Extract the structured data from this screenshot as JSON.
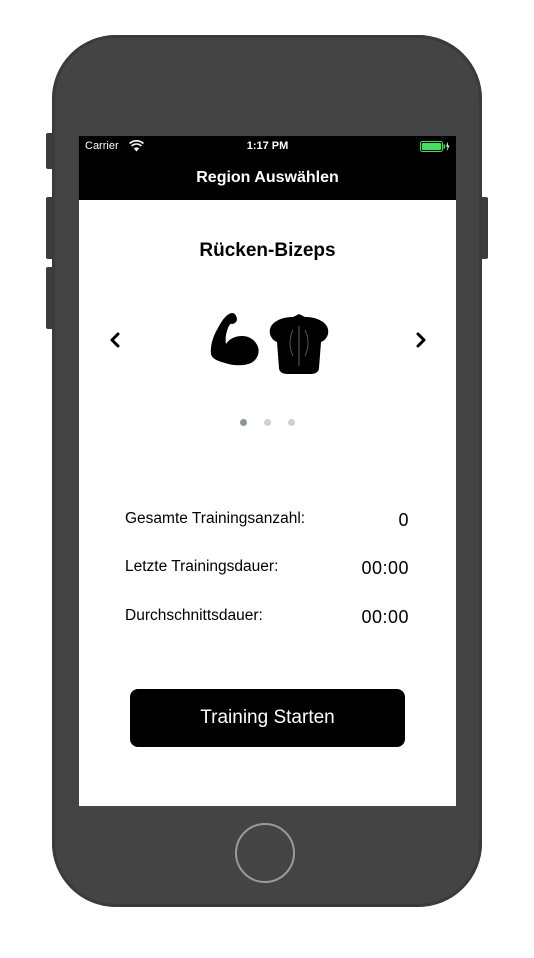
{
  "status_bar": {
    "carrier": "Carrier",
    "time": "1:17 PM"
  },
  "nav": {
    "title": "Region Auswählen"
  },
  "carousel": {
    "region_title": "Rücken-Bizeps",
    "page_count": 3,
    "active_page": 1,
    "icons": [
      "biceps-icon",
      "back-torso-icon"
    ]
  },
  "stats": [
    {
      "label": "Gesamte Trainingsanzahl:",
      "value": "0"
    },
    {
      "label": "Letzte Trainingsdauer:",
      "value": "00:00"
    },
    {
      "label": "Durchschnittsdauer:",
      "value": "00:00"
    }
  ],
  "actions": {
    "start_label": "Training Starten"
  },
  "colors": {
    "bar_background": "#000000",
    "battery": "#4cd964",
    "page_dot_active": "#8a939d",
    "page_dot": "#c9d1db"
  }
}
